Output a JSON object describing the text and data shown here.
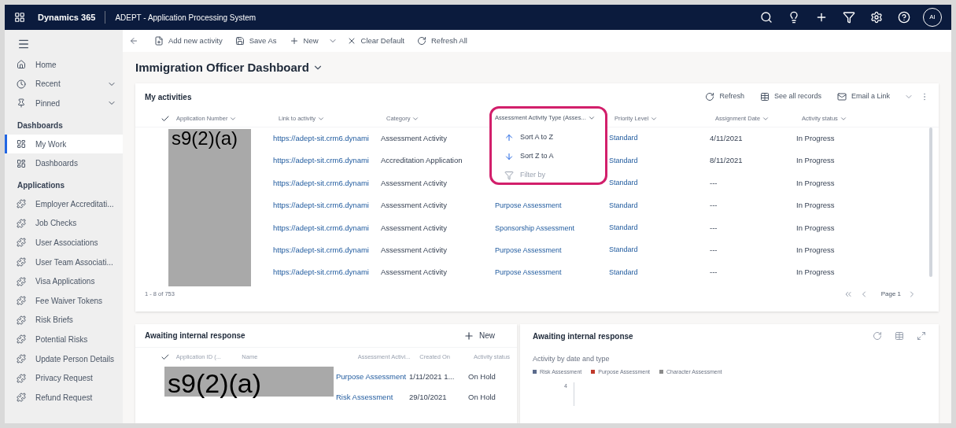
{
  "top_bar": {
    "app_name": "Dynamics 365",
    "title": "ADEPT - Application Processing System",
    "avatar": "AI"
  },
  "sidebar": {
    "items": [
      {
        "kind": "home",
        "label": "Home",
        "selected": false,
        "expandable": false
      },
      {
        "kind": "recent",
        "label": "Recent",
        "selected": false,
        "expandable": true
      },
      {
        "kind": "pinned",
        "label": "Pinned",
        "selected": false,
        "expandable": true
      },
      {
        "kind": "heading",
        "label": "Dashboards"
      },
      {
        "kind": "dashboard",
        "label": "My Work",
        "selected": true,
        "expandable": false
      },
      {
        "kind": "dashboard",
        "label": "Dashboards",
        "selected": false,
        "expandable": false
      },
      {
        "kind": "heading",
        "label": "Applications"
      },
      {
        "kind": "entity",
        "label": "Employer Accreditati...",
        "selected": false,
        "expandable": false
      },
      {
        "kind": "entity",
        "label": "Job Checks",
        "selected": false,
        "expandable": false
      },
      {
        "kind": "entity",
        "label": "User Associations",
        "selected": false,
        "expandable": false
      },
      {
        "kind": "entity",
        "label": "User Team Associati...",
        "selected": false,
        "expandable": false
      },
      {
        "kind": "entity",
        "label": "Visa Applications",
        "selected": false,
        "expandable": false
      },
      {
        "kind": "entity",
        "label": "Fee Waiver Tokens",
        "selected": false,
        "expandable": false
      },
      {
        "kind": "entity",
        "label": "Risk Briefs",
        "selected": false,
        "expandable": false
      },
      {
        "kind": "entity",
        "label": "Potential Risks",
        "selected": false,
        "expandable": false
      },
      {
        "kind": "entity",
        "label": "Update Person Details",
        "selected": false,
        "expandable": false
      },
      {
        "kind": "entity",
        "label": "Privacy Request",
        "selected": false,
        "expandable": false
      },
      {
        "kind": "entity",
        "label": "Refund Request",
        "selected": false,
        "expandable": false
      }
    ]
  },
  "command_bar": [
    {
      "kind": "add",
      "label": "Add new activity"
    },
    {
      "kind": "save",
      "label": "Save As"
    },
    {
      "kind": "new",
      "label": "New"
    },
    {
      "kind": "clear",
      "label": "Clear Default"
    },
    {
      "kind": "refresh",
      "label": "Refresh All"
    }
  ],
  "dashboard_title": "Immigration Officer Dashboard",
  "activities": {
    "title": "My activities",
    "actions": [
      {
        "kind": "refresh",
        "label": "Refresh"
      },
      {
        "kind": "records",
        "label": "See all records"
      },
      {
        "kind": "email",
        "label": "Email a Link"
      }
    ],
    "columns": [
      "Application Number",
      "Link to activity",
      "Category",
      "Assessment Activity Type (Asses...",
      "Priority Level",
      "Assignment Date",
      "Activity status"
    ],
    "redaction": "s9(2)(a)",
    "rows": [
      {
        "link": "https://adept-sit.crm6.dynami",
        "category": "Assessment Activity",
        "priority": "Standard",
        "date": "4/11/2021",
        "status": "In Progress"
      },
      {
        "link": "https://adept-sit.crm6.dynami",
        "category": "Accreditation Application",
        "priority": "Standard",
        "date": "8/11/2021",
        "status": "In Progress"
      },
      {
        "link": "https://adept-sit.crm6.dynami",
        "category": "Assessment Activity",
        "priority": "Standard",
        "date": "---",
        "status": "In Progress"
      },
      {
        "link": "https://adept-sit.crm6.dynami",
        "category": "Assessment Activity",
        "type": "Purpose Assessment",
        "priority": "Standard",
        "date": "---",
        "status": "In Progress"
      },
      {
        "link": "https://adept-sit.crm6.dynami",
        "category": "Assessment Activity",
        "type": "Sponsorship Assessment",
        "priority": "Standard",
        "date": "---",
        "status": "In Progress"
      },
      {
        "link": "https://adept-sit.crm6.dynami",
        "category": "Assessment Activity",
        "type": "Purpose Assessment",
        "priority": "Standard",
        "date": "---",
        "status": "In Progress"
      },
      {
        "link": "https://adept-sit.crm6.dynami",
        "category": "Assessment Activity",
        "type": "Purpose Assessment",
        "priority": "Standard",
        "date": "---",
        "status": "In Progress"
      }
    ],
    "count": "1 - 8 of 753",
    "page": "Page 1",
    "column_menu": [
      {
        "kind": "sort_up",
        "label": "Sort A to Z",
        "disabled": false
      },
      {
        "kind": "sort_down",
        "label": "Sort Z to A",
        "disabled": false
      },
      {
        "kind": "filter",
        "label": "Filter by",
        "disabled": true
      }
    ]
  },
  "awaiting": {
    "title": "Awaiting internal response",
    "new_label": "New",
    "columns": [
      "Application ID (...",
      "Name",
      "Assessment Activi...",
      "Created On",
      "Activity status"
    ],
    "redaction": "s9(2)(a)",
    "rows": [
      {
        "type": "Purpose Assessment",
        "created": "1/11/2021 1...",
        "status": "On Hold"
      },
      {
        "type": "Risk Assessment",
        "created": "29/10/2021",
        "status": "On Hold"
      }
    ]
  },
  "chart_panel": {
    "title": "Awaiting internal response",
    "chart_title": "Activity by date and type",
    "legend": [
      {
        "label": "Risk Assessment",
        "color": "#5b6b8c"
      },
      {
        "label": "Purpose Assessment",
        "color": "#c0392b"
      },
      {
        "label": "Character Assessment",
        "color": "#8a8a8a"
      }
    ],
    "ytick": "4"
  }
}
